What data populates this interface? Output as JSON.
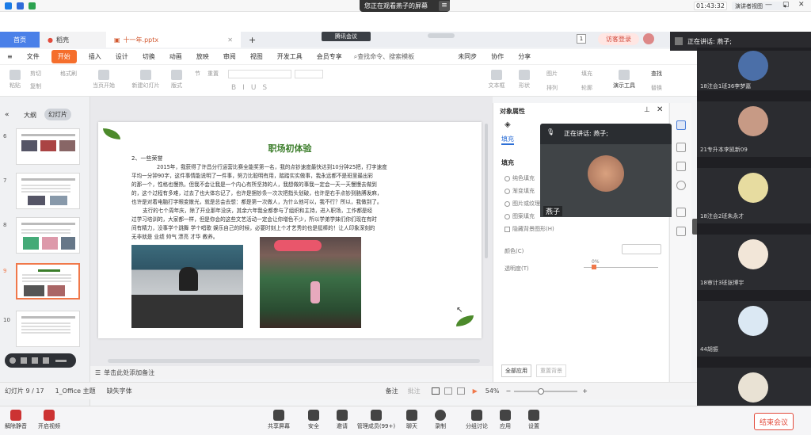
{
  "sysbar": {
    "share_banner": "您正在观看燕子的屏幕",
    "timer": "01:43:32",
    "view_mode": "演讲者视图"
  },
  "tabs": {
    "home": "首页",
    "doc": "稻壳",
    "file": "十一年.pptx",
    "meeting_tag": "腾讯会议",
    "badge": "1",
    "login": "访客登录"
  },
  "menu": {
    "items": [
      "文件",
      "开始",
      "插入",
      "设计",
      "切换",
      "动画",
      "放映",
      "审阅",
      "视图",
      "开发工具",
      "会员专享"
    ],
    "search": "查找命令、搜索模板",
    "unsynced": "未同步",
    "collab": "协作",
    "share": "分享"
  },
  "ribbon": {
    "paste": "粘贴",
    "cut": "剪切",
    "copy": "复制",
    "format_painter": "格式刷",
    "from_start": "当页开始",
    "new_slide": "新建幻灯片",
    "layout": "版式",
    "section": "节",
    "reset": "重置",
    "textbox": "文本框",
    "shape": "形状",
    "arrange": "排列",
    "picture": "图片",
    "fill": "填充",
    "outline": "轮廓",
    "presenter": "演示工具",
    "find": "查找",
    "replace": "替换"
  },
  "leftpanel": {
    "outline": "大纲",
    "slides": "幻灯片",
    "slide_numbers": [
      "6",
      "7",
      "8",
      "9",
      "10"
    ],
    "active_index": 3
  },
  "slide": {
    "title": "职场初体验",
    "subtitle": "2、一些荣誉",
    "lines": [
      "2015年，我获得了许昌分行运营比赛全能奖第一名，我的点钞速度最快达到10分钟25把，打字速度",
      "平均一分钟90字，这件事情能说明了一件事，努力比聪明有用，踏踏实实做事，我永远都不是班里最出彩",
      "的那一个，性格也慢热，但我不会让我是一个内心有所坚持的人，我想做的事我一定会一天一天慢慢去做到",
      "的，这个过程有多难，过去了也大体忘记了，也许是捆钞条一次次把指头划破，也许是右手点钞到胳膊发麻，",
      "也许是对着电脑打字眼变散光，就是总会去想：都是第一次做人，为什么他可以，我不行？所以，我做到了。",
      "支行的七个周年庆，除了开业那年没庆，其余六年我全都参与了组织和主持，进入职场，工作都是经",
      "过学习培训的，大家都一样，但是你会的这些文艺活动一定会让你增色不少，所以学弟学妹们你们现在有时",
      "间有精力，没事学个跳舞 学个唱歌 娱乐自己的时候，必要时刻上个才艺秀的也是挺棒的！让人印象深刻的",
      "无非就是 业绩 帅气 漂亮 才华 教养。"
    ]
  },
  "notes": {
    "placeholder": "单击此处添加备注"
  },
  "objpane": {
    "title": "对象属性",
    "fill_tab": "填充",
    "fill_header": "填充",
    "options": [
      "纯色填充",
      "渐变填充",
      "图片或纹理填充",
      "图案填充"
    ],
    "hide_bg": "隐藏背景图形(H)",
    "color_label": "颜色(C)",
    "transparency_label": "透明度(T)",
    "transparency_value": "0%",
    "apply_all": "全部应用",
    "reset_bg": "重置背景"
  },
  "speaker": {
    "label": "正在讲话: 燕子;",
    "name": "燕子"
  },
  "statusbar": {
    "slide_info": "幻灯片 9 / 17",
    "theme": "1_Office 主题",
    "missing_font": "缺失字体",
    "notes": "备注",
    "comments": "批注",
    "zoom": "54%"
  },
  "sidebar": {
    "speaking": "正在讲话: 燕子;",
    "participants": [
      {
        "name": "18注会1班36李梦嘉"
      },
      {
        "name": "21专升本李凯新09"
      },
      {
        "name": "18注会2班朱永才"
      },
      {
        "name": "18审计3班张博宇"
      },
      {
        "name": "44胡振"
      }
    ]
  },
  "meetbar": {
    "unmute": "解除静音",
    "video": "开启视频",
    "share": "共享屏幕",
    "security": "安全",
    "invite": "邀请",
    "members": "管理成员(99+)",
    "chat": "聊天",
    "record": "录制",
    "breakout": "分组讨论",
    "apps": "应用",
    "settings": "设置",
    "end": "结束会议"
  }
}
